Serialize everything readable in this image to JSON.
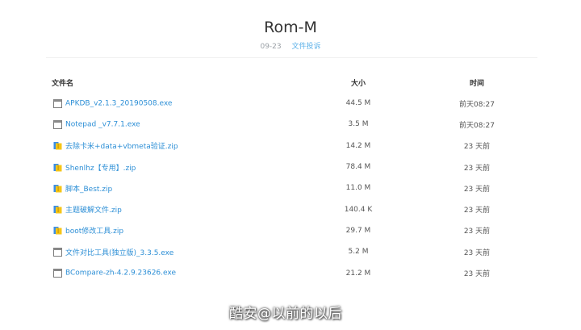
{
  "header": {
    "title": "Rom-M",
    "date": "09-23",
    "link_label": "文件投诉"
  },
  "table": {
    "columns": {
      "name": "文件名",
      "size": "大小",
      "time": "时间"
    },
    "rows": [
      {
        "icon": "exe-file-icon",
        "name": "APKDB_v2.1.3_20190508.exe",
        "size": "44.5 M",
        "time": "前天08:27"
      },
      {
        "icon": "exe-file-icon",
        "name": "Notepad _v7.7.1.exe",
        "size": "3.5 M",
        "time": "前天08:27"
      },
      {
        "icon": "zip-file-icon",
        "name": "去除卡米+data+vbmeta验证.zip",
        "size": "14.2 M",
        "time": "23 天前"
      },
      {
        "icon": "zip-file-icon",
        "name": "Shenlhz【专用】.zip",
        "size": "78.4 M",
        "time": "23 天前"
      },
      {
        "icon": "zip-file-icon",
        "name": "脚本_Best.zip",
        "size": "11.0 M",
        "time": "23 天前"
      },
      {
        "icon": "zip-file-icon",
        "name": "主题破解文件.zip",
        "size": "140.4 K",
        "time": "23 天前"
      },
      {
        "icon": "zip-file-icon",
        "name": "boot修改工具.zip",
        "size": "29.7 M",
        "time": "23 天前"
      },
      {
        "icon": "exe-file-icon",
        "name": "文件对比工具(独立版)_3.3.5.exe",
        "size": "5.2 M",
        "time": "23 天前"
      },
      {
        "icon": "exe-file-icon",
        "name": "BCompare-zh-4.2.9.23626.exe",
        "size": "21.2 M",
        "time": "23 天前"
      }
    ]
  },
  "watermark": "酷安@以前的以后",
  "colors": {
    "link": "#2d8fd6",
    "meta_link": "#5ab0e8",
    "meta_text": "#9aa0a6",
    "zip_icon_yellow": "#f5c518",
    "zip_icon_blue": "#3a8ee6"
  }
}
